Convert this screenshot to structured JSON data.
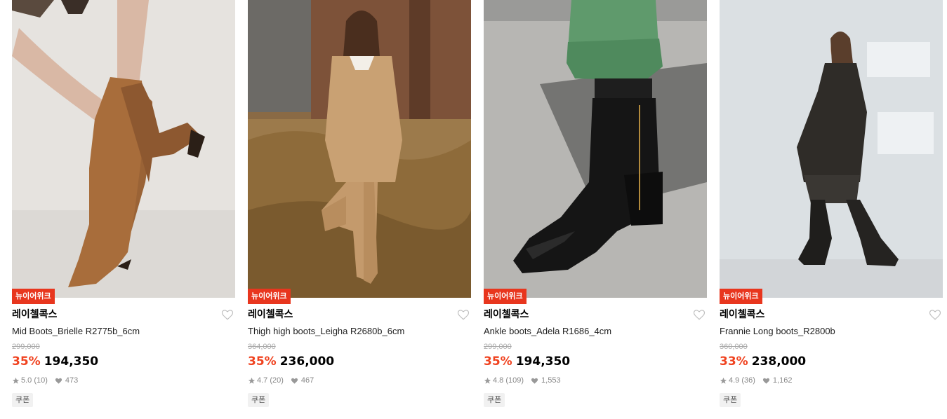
{
  "products": [
    {
      "tag": "뉴이어위크",
      "brand": "레이첼콕스",
      "name": "Mid Boots_Brielle R2775b_6cm",
      "original_price": "299,000",
      "discount": "35%",
      "price": "194,350",
      "rating": "5.0",
      "reviews": "(10)",
      "likes": "473",
      "coupon": "쿠폰"
    },
    {
      "tag": "뉴이어위크",
      "brand": "레이첼콕스",
      "name": "Thigh high boots_Leigha R2680b_6cm",
      "original_price": "364,000",
      "discount": "35%",
      "price": "236,000",
      "rating": "4.7",
      "reviews": "(20)",
      "likes": "467",
      "coupon": "쿠폰"
    },
    {
      "tag": "뉴이어위크",
      "brand": "레이첼콕스",
      "name": "Ankle boots_Adela R1686_4cm",
      "original_price": "299,000",
      "discount": "35%",
      "price": "194,350",
      "rating": "4.8",
      "reviews": "(109)",
      "likes": "1,553",
      "coupon": "쿠폰"
    },
    {
      "tag": "뉴이어위크",
      "brand": "레이첼콕스",
      "name": "Frannie Long boots_R2800b",
      "original_price": "360,000",
      "discount": "33%",
      "price": "238,000",
      "rating": "4.9",
      "reviews": "(36)",
      "likes": "1,162",
      "coupon": "쿠폰"
    }
  ],
  "colors": {
    "discount": "#f0421f",
    "tag_bg": "#e8361e",
    "muted": "#888888"
  }
}
